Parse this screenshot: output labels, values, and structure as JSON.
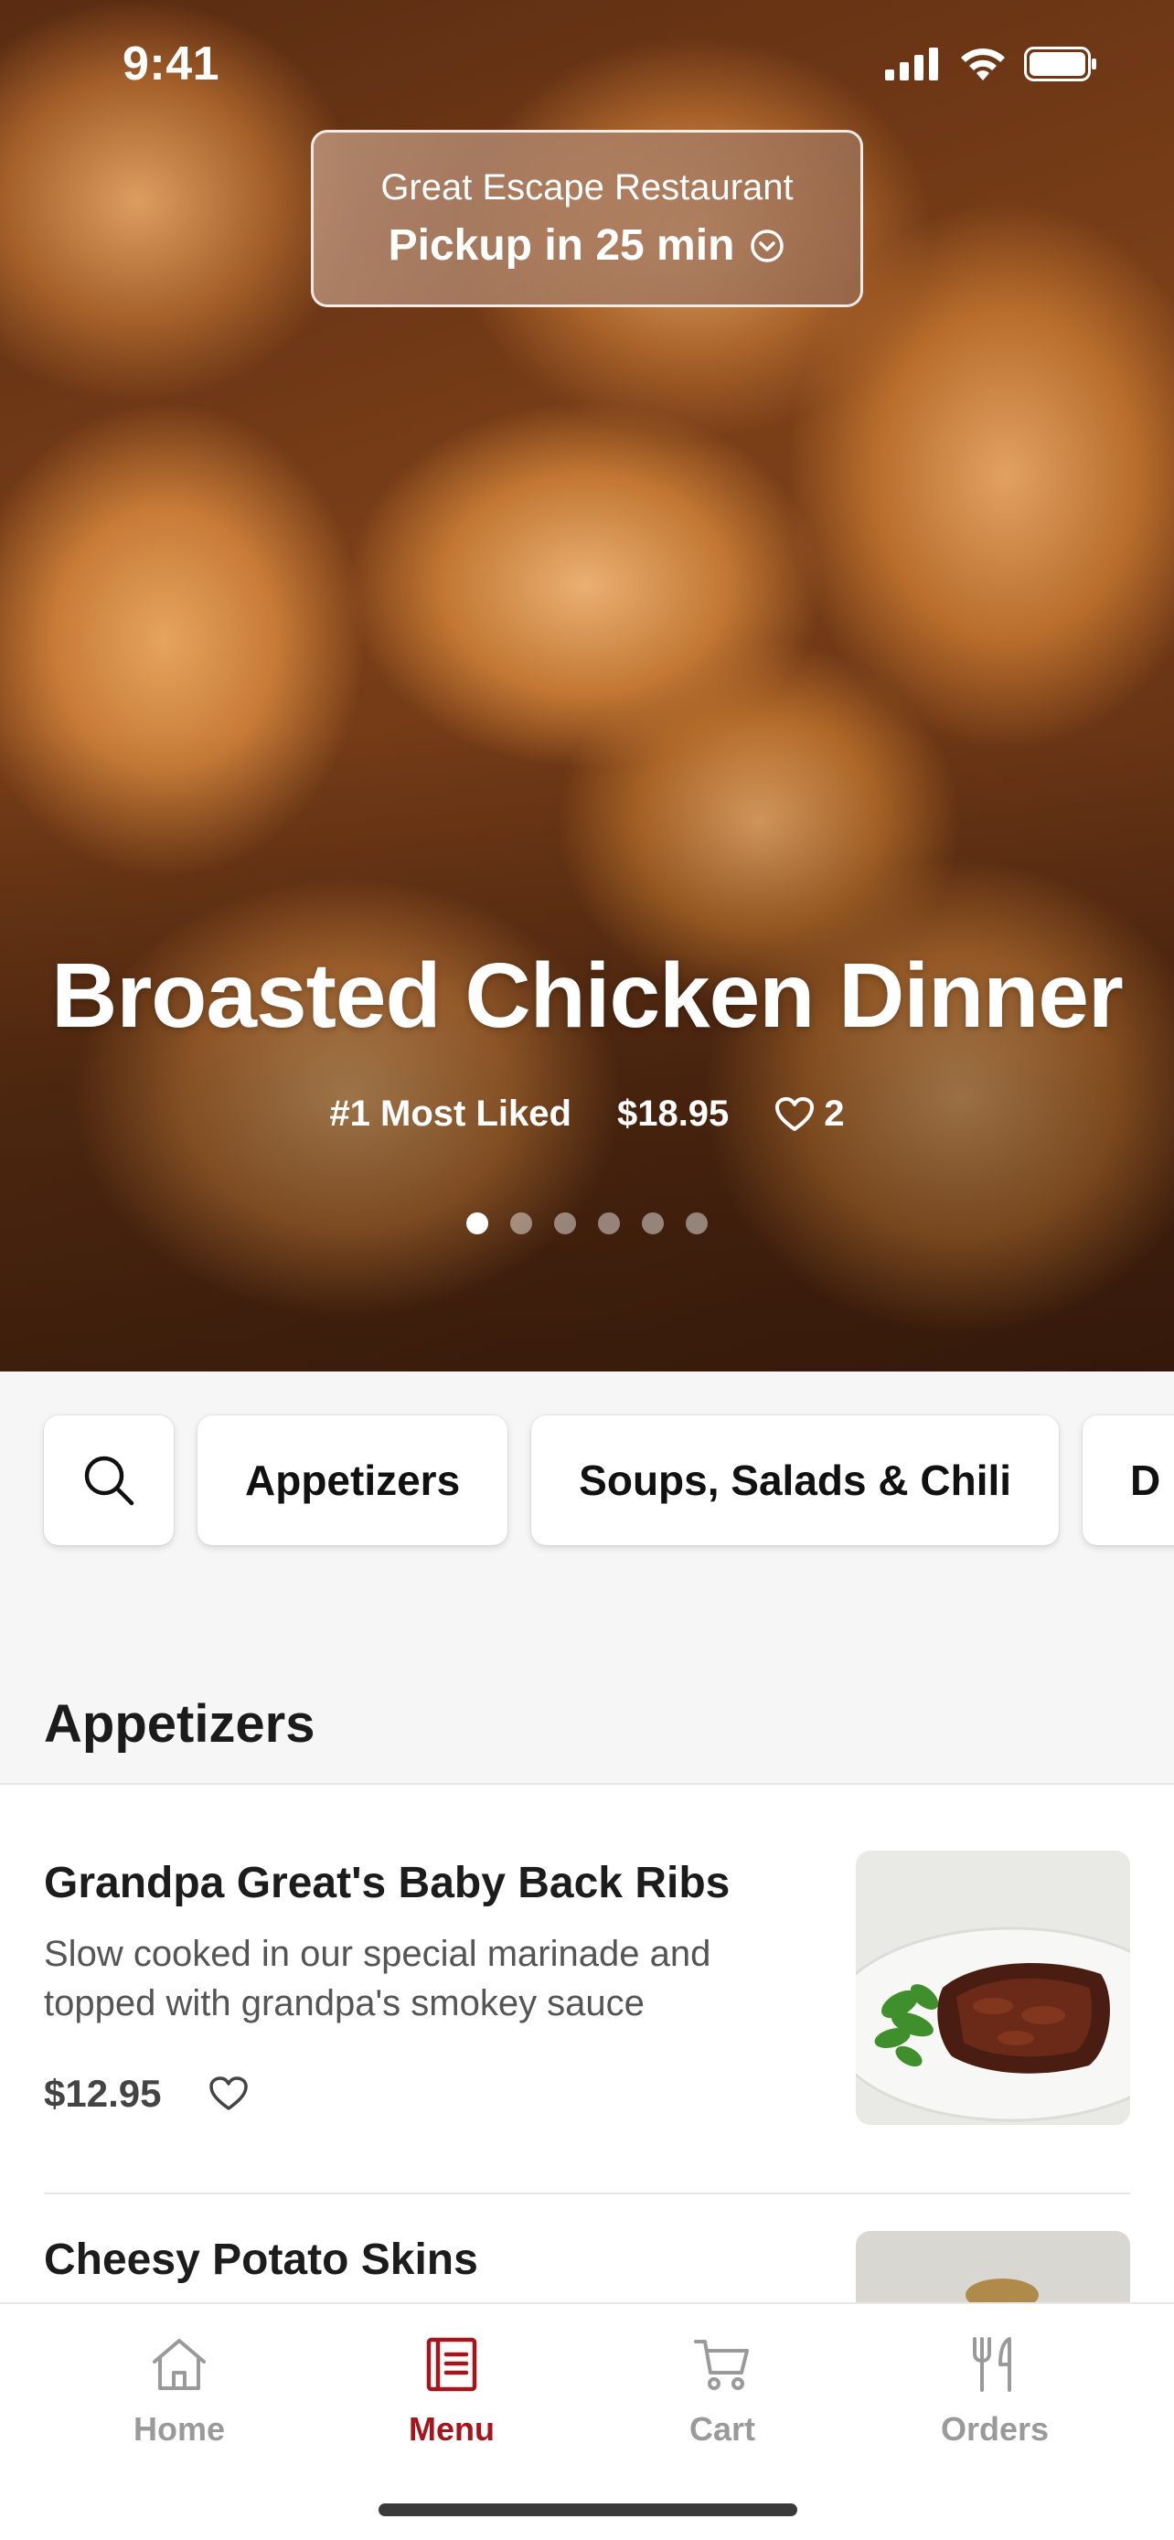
{
  "status_bar": {
    "time": "9:41"
  },
  "location": {
    "restaurant_name": "Great Escape Restaurant",
    "pickup_text": "Pickup in 25 min"
  },
  "featured": {
    "title": "Broasted Chicken Dinner",
    "tag": "#1 Most Liked",
    "price": "$18.95",
    "likes": "2",
    "carousel_pages": 6,
    "active_page": 1
  },
  "categories": [
    {
      "label": "Appetizers"
    },
    {
      "label": "Soups, Salads & Chili"
    },
    {
      "label": "D"
    }
  ],
  "section": {
    "title": "Appetizers"
  },
  "menu_items": [
    {
      "name": "Grandpa Great's Baby Back Ribs",
      "description": "Slow cooked in our special marinade and topped with grandpa's smokey sauce",
      "price": "$12.95"
    },
    {
      "name": "Cheesy Potato Skins",
      "description": "",
      "price": ""
    }
  ],
  "tabs": [
    {
      "label": "Home",
      "icon": "home-icon",
      "active": false
    },
    {
      "label": "Menu",
      "icon": "menu-icon",
      "active": true
    },
    {
      "label": "Cart",
      "icon": "cart-icon",
      "active": false
    },
    {
      "label": "Orders",
      "icon": "orders-icon",
      "active": false
    }
  ],
  "colors": {
    "accent": "#a7151c",
    "inactive_tab": "#9a9a9a",
    "background": "#f6f6f6"
  }
}
